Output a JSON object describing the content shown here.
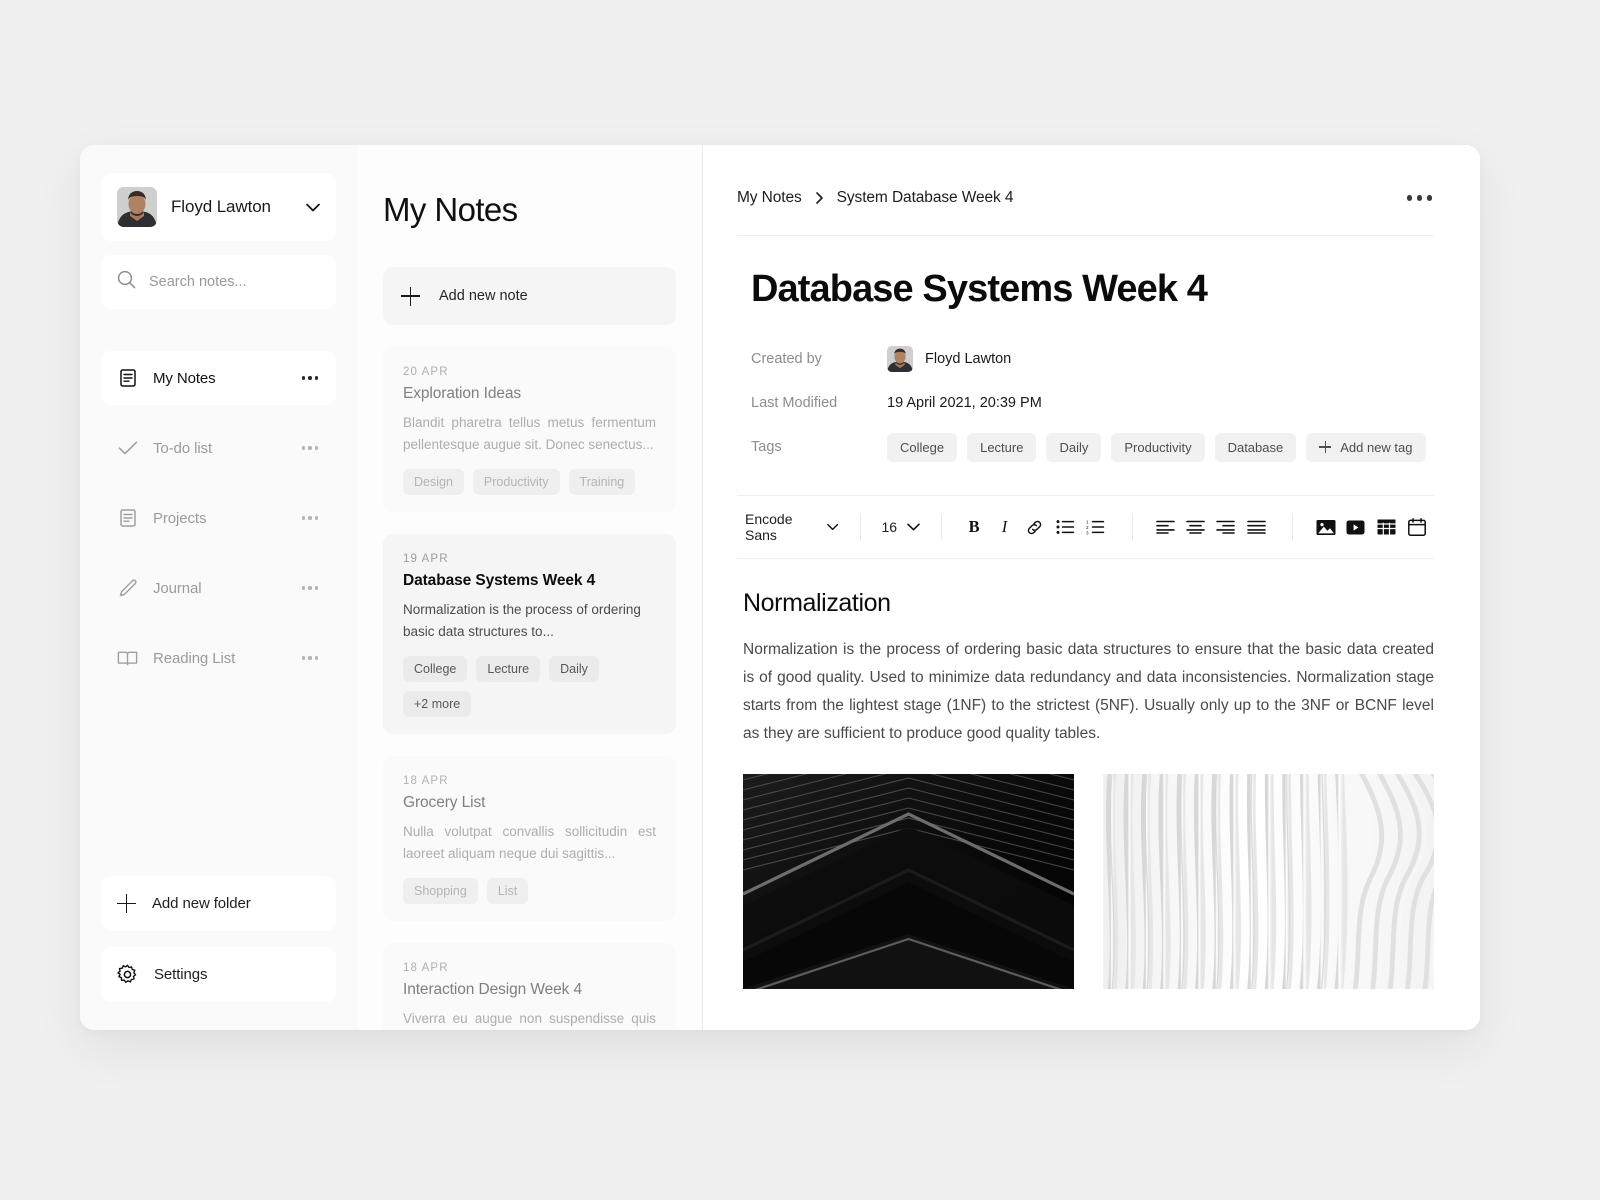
{
  "sidebar": {
    "profile": {
      "name": "Floyd Lawton",
      "avatar_icon": "user-avatar",
      "chevron_icon": "chevron-down-icon"
    },
    "search": {
      "placeholder": "Search notes...",
      "value": "",
      "icon": "search-icon"
    },
    "items": [
      {
        "label": "My Notes",
        "icon": "document-icon",
        "active": true
      },
      {
        "label": "To-do list",
        "icon": "check-icon",
        "active": false
      },
      {
        "label": "Projects",
        "icon": "document-icon",
        "active": false
      },
      {
        "label": "Journal",
        "icon": "pencil-icon",
        "active": false
      },
      {
        "label": "Reading List",
        "icon": "book-icon",
        "active": false
      }
    ],
    "add_folder_label": "Add new folder",
    "settings_label": "Settings"
  },
  "notes_panel": {
    "title": "My Notes",
    "add_note_label": "Add new note",
    "notes": [
      {
        "date": "20 APR",
        "title": "Exploration Ideas",
        "excerpt": "Blandit pharetra tellus metus fermentum pellentesque augue sit. Donec senectus...",
        "tags": [
          "Design",
          "Productivity",
          "Training"
        ],
        "selected": false
      },
      {
        "date": "19 APR",
        "title": "Database Systems Week 4",
        "excerpt": "Normalization is the process of ordering basic data structures to...",
        "tags": [
          "College",
          "Lecture",
          "Daily",
          "+2 more"
        ],
        "selected": true
      },
      {
        "date": "18 APR",
        "title": "Grocery List",
        "excerpt": "Nulla volutpat convallis sollicitudin est laoreet aliquam neque dui sagittis...",
        "tags": [
          "Shopping",
          "List"
        ],
        "selected": false
      },
      {
        "date": "18 APR",
        "title": "Interaction Design Week 4",
        "excerpt": "Viverra eu augue non suspendisse quis quis pellentesque facilisi...",
        "tags": [],
        "selected": false
      }
    ]
  },
  "document": {
    "breadcrumb": {
      "root": "My Notes",
      "current": "System Database Week 4",
      "separator_icon": "chevron-right-icon"
    },
    "more_menu_icon": "kebab-menu-icon",
    "title": "Database Systems Week 4",
    "meta": {
      "created_by_label": "Created by",
      "created_by_value": "Floyd Lawton",
      "last_modified_label": "Last Modified",
      "last_modified_value": "19 April 2021, 20:39 PM",
      "tags_label": "Tags",
      "tags": [
        "College",
        "Lecture",
        "Daily",
        "Productivity",
        "Database"
      ],
      "add_tag_label": "Add new tag"
    },
    "toolbar": {
      "font_family": "Encode Sans",
      "font_size": "16",
      "bold_label": "B",
      "italic_label": "I",
      "buttons": [
        "link-icon",
        "bulleted-list-icon",
        "numbered-list-icon",
        "align-left-icon",
        "align-center-icon",
        "align-right-icon",
        "align-justify-icon",
        "image-icon",
        "video-icon",
        "table-icon",
        "calendar-icon"
      ]
    },
    "section_title": "Normalization",
    "section_body": "Normalization is the process of ordering basic data structures to ensure that the basic data created is of good quality. Used to minimize data redundancy and data inconsistencies. Normalization stage starts from the lightest stage (1NF) to the strictest (5NF). Usually only up to the 3NF or BCNF level as they are sufficient to produce good quality tables.",
    "images": [
      {
        "name": "dark-chevron-architecture-image"
      },
      {
        "name": "white-ribbed-architecture-image"
      }
    ]
  },
  "colors": {
    "page_bg": "#f0f0f0",
    "panel_bg": "#ffffff",
    "sidebar_bg": "#fafafa",
    "chip_bg": "#f1f1f1",
    "text": "#0b0b0b",
    "muted": "#9b9b9b"
  }
}
